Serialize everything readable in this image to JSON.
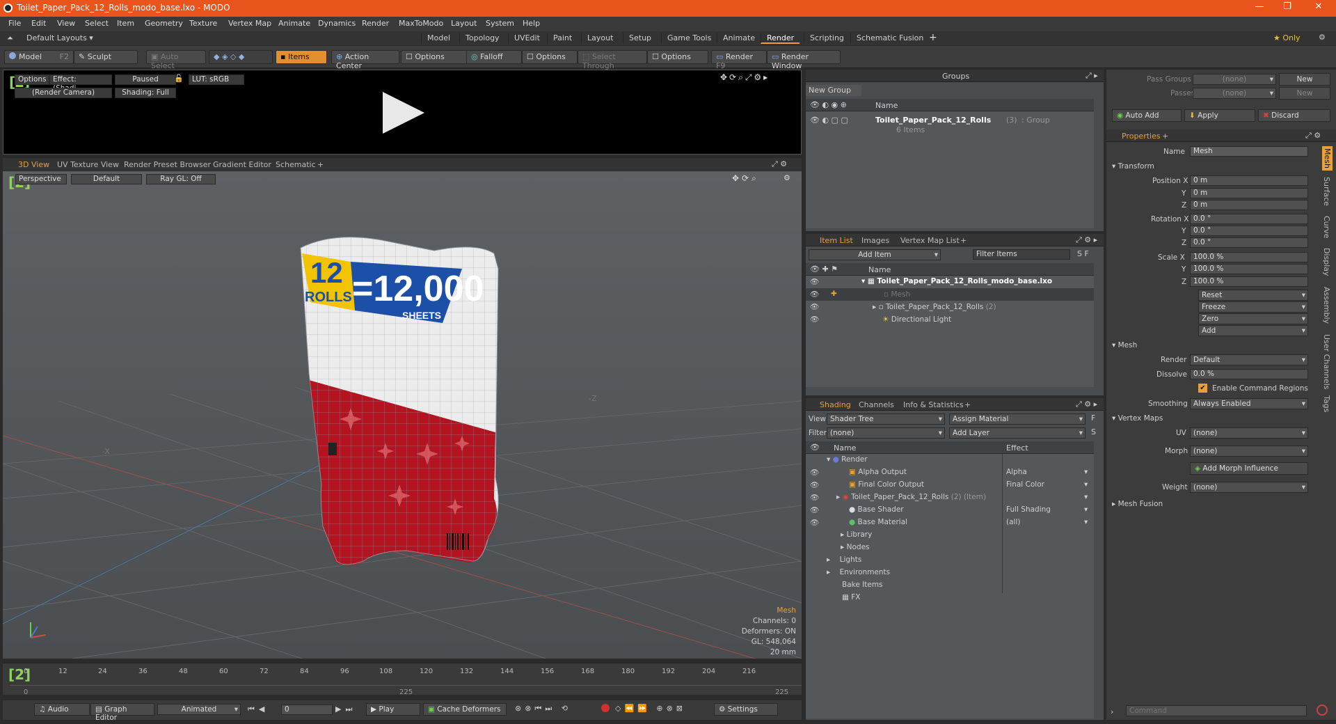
{
  "window": {
    "title": "Toilet_Paper_Pack_12_Rolls_modo_base.lxo - MODO",
    "minimize": "—",
    "maximize": "❐",
    "close": "✕"
  },
  "menu": [
    "File",
    "Edit",
    "View",
    "Select",
    "Item",
    "Geometry",
    "Texture",
    "Vertex Map",
    "Animate",
    "Dynamics",
    "Render",
    "MaxToModo",
    "Layout",
    "System",
    "Help"
  ],
  "layouts": {
    "label": "Default Layouts ▾",
    "tabs": [
      "Model",
      "Topology",
      "UVEdit",
      "Paint",
      "Layout",
      "Setup",
      "Game Tools",
      "Animate",
      "Render",
      "Scripting",
      "Schematic Fusion"
    ],
    "active": "Render",
    "plus": "+",
    "only": "★ Only",
    "gear": "⚙"
  },
  "toolbar": {
    "model": "Model",
    "model_key": "F2",
    "sculpt": "Sculpt",
    "auto_select": "Auto Select",
    "items": "Items",
    "action_center": "Action Center",
    "options1": "Options",
    "falloff": "Falloff",
    "options2": "Options",
    "select_through": "Select Through",
    "options3": "Options",
    "render": "Render",
    "render_key": "F9",
    "render_window": "Render Window"
  },
  "preview": {
    "options": "Options",
    "effect": "Effect: (Shadi...",
    "paused": "Paused",
    "lut": "LUT: sRGB",
    "camera": "(Render Camera)",
    "shading": "Shading: Full"
  },
  "viewport_tabs": [
    "3D View",
    "UV Texture View",
    "Render Preset Browser",
    "Gradient Editor",
    "Schematic",
    "+"
  ],
  "viewport": {
    "perspective": "Perspective",
    "default": "Default",
    "raygl": "Ray GL: Off",
    "axis_x": "-X",
    "axis_z": "-Z",
    "stats": {
      "title": "Mesh",
      "channels": "Channels: 0",
      "deformers": "Deformers: ON",
      "gl": "GL: 548,064",
      "size": "20 mm"
    }
  },
  "package": {
    "rolls_num": "12",
    "rolls_txt": "ROLLS",
    "sheets_num": "=12,000",
    "sheets_txt": "SHEETS"
  },
  "timeline": {
    "ticks": [
      "0",
      "12",
      "24",
      "36",
      "48",
      "60",
      "72",
      "84",
      "96",
      "108",
      "120",
      "132",
      "144",
      "156",
      "168",
      "180",
      "192",
      "204",
      "216"
    ],
    "start": "0",
    "end": "225",
    "mid": "225"
  },
  "bottombar": {
    "audio": "Audio",
    "graph_editor": "Graph Editor",
    "animated": "Animated",
    "frame": "0",
    "play": "Play",
    "cache": "Cache Deformers",
    "settings": "Settings"
  },
  "groups": {
    "title": "Groups",
    "new_group": "New Group",
    "col_name": "Name",
    "item_name": "Toilet_Paper_Pack_12_Rolls",
    "item_count": "(3)",
    "item_type": ": Group",
    "item_sub": "6 Items"
  },
  "itemlist": {
    "tabs": [
      "Item List",
      "Images",
      "Vertex Map List",
      "+"
    ],
    "add_item": "Add Item",
    "filter": "Filter Items",
    "col_name": "Name",
    "rows": [
      {
        "label": "Toilet_Paper_Pack_12_Rolls_modo_base.lxo",
        "indent": 0
      },
      {
        "label": "Mesh",
        "indent": 2
      },
      {
        "label": "Toilet_Paper_Pack_12_Rolls",
        "count": "(2)",
        "indent": 1
      },
      {
        "label": "Directional Light",
        "indent": 1
      }
    ]
  },
  "shading": {
    "tabs": [
      "Shading",
      "Channels",
      "Info & Statistics",
      "+"
    ],
    "view_label": "View",
    "view_value": "Shader Tree",
    "assign": "Assign Material",
    "filter_label": "Filter",
    "filter_value": "(none)",
    "add_layer": "Add Layer",
    "col_name": "Name",
    "col_effect": "Effect",
    "rows": [
      {
        "name": "Render",
        "effect": ""
      },
      {
        "name": "Alpha Output",
        "effect": "Alpha"
      },
      {
        "name": "Final Color Output",
        "effect": "Final Color"
      },
      {
        "name": "Toilet_Paper_Pack_12_Rolls",
        "suffix": "(2) (Item)",
        "effect": ""
      },
      {
        "name": "Base Shader",
        "effect": "Full Shading"
      },
      {
        "name": "Base Material",
        "effect": "(all)"
      },
      {
        "name": "Library",
        "effect": ""
      },
      {
        "name": "Nodes",
        "effect": ""
      },
      {
        "name": "Lights",
        "effect": ""
      },
      {
        "name": "Environments",
        "effect": ""
      },
      {
        "name": "Bake Items",
        "effect": ""
      },
      {
        "name": "FX",
        "effect": ""
      }
    ]
  },
  "passes": {
    "pass_groups": "Pass Groups",
    "pass_groups_val": "(none)",
    "passes": "Passes",
    "passes_val": "(none)",
    "new": "New",
    "new2": "New",
    "auto_add": "Auto Add",
    "apply": "Apply",
    "discard": "Discard"
  },
  "properties": {
    "tab": "Properties",
    "plus": "+",
    "name_label": "Name",
    "name_value": "Mesh",
    "transform": "Transform",
    "pos_label": "Position X",
    "rot_label": "Rotation X",
    "scale_label": "Scale X",
    "y": "Y",
    "z": "Z",
    "pos": [
      "0 m",
      "0 m",
      "0 m"
    ],
    "rot": [
      "0.0 °",
      "0.0 °",
      "0.0 °"
    ],
    "scale": [
      "100.0 %",
      "100.0 %",
      "100.0 %"
    ],
    "reset": "Reset",
    "freeze": "Freeze",
    "zero": "Zero",
    "add": "Add",
    "mesh": "Mesh",
    "render_label": "Render",
    "render_value": "Default",
    "dissolve_label": "Dissolve",
    "dissolve_value": "0.0 %",
    "enable_cmd": "Enable Command Regions",
    "smoothing_label": "Smoothing",
    "smoothing_value": "Always Enabled",
    "vertex_maps": "Vertex Maps",
    "uv_label": "UV",
    "uv_value": "(none)",
    "morph_label": "Morph",
    "morph_value": "(none)",
    "add_morph": "Add Morph Influence",
    "weight_label": "Weight",
    "weight_value": "(none)",
    "mesh_fusion": "Mesh Fusion",
    "side_tabs": [
      "Mesh",
      "Surface",
      "Curve",
      "Display",
      "Assembly",
      "User Channels",
      "Tags"
    ]
  },
  "command": {
    "placeholder": "Command"
  }
}
